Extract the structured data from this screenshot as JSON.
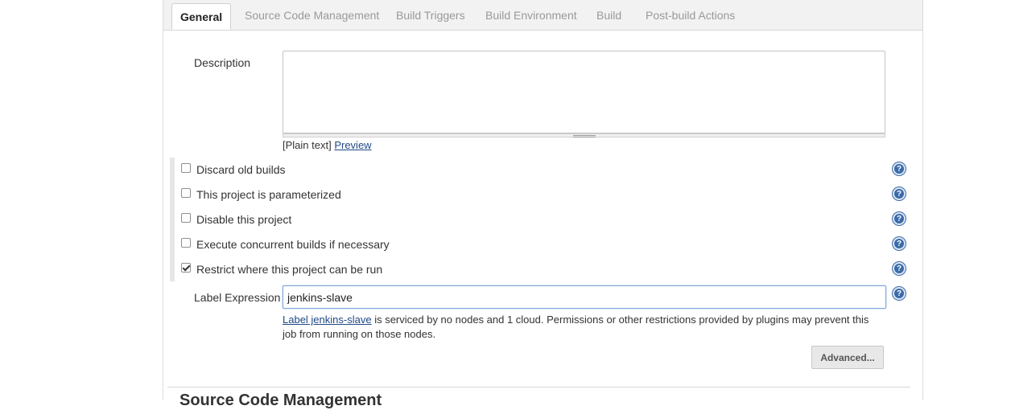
{
  "tabs": [
    {
      "label": "General",
      "active": true
    },
    {
      "label": "Source Code Management",
      "active": false
    },
    {
      "label": "Build Triggers",
      "active": false
    },
    {
      "label": "Build Environment",
      "active": false
    },
    {
      "label": "Build",
      "active": false
    },
    {
      "label": "Post-build Actions",
      "active": false
    }
  ],
  "description": {
    "label": "Description",
    "value": "",
    "format_prefix": "[Plain text]",
    "preview_link": "Preview"
  },
  "options": [
    {
      "label": "Discard old builds",
      "checked": false
    },
    {
      "label": "This project is parameterized",
      "checked": false
    },
    {
      "label": "Disable this project",
      "checked": false
    },
    {
      "label": "Execute concurrent builds if necessary",
      "checked": false
    },
    {
      "label": "Restrict where this project can be run",
      "checked": true
    }
  ],
  "label_expression": {
    "label": "Label Expression",
    "value": "jenkins-slave",
    "info_link": "Label jenkins-slave",
    "info_text": " is serviced by no nodes and 1 cloud. Permissions or other restrictions provided by plugins may prevent this job from running on those nodes."
  },
  "advanced_button": "Advanced...",
  "next_section_title": "Source Code Management",
  "help_glyph": "?",
  "icons": {
    "help": "question-circle-icon",
    "checkbox": "checkbox",
    "grip": "resize-grip-icon"
  },
  "colors": {
    "link": "#204a87",
    "help": "#3b6aa8",
    "tab_inactive": "#999999",
    "input_focus": "#7fa7d6"
  }
}
